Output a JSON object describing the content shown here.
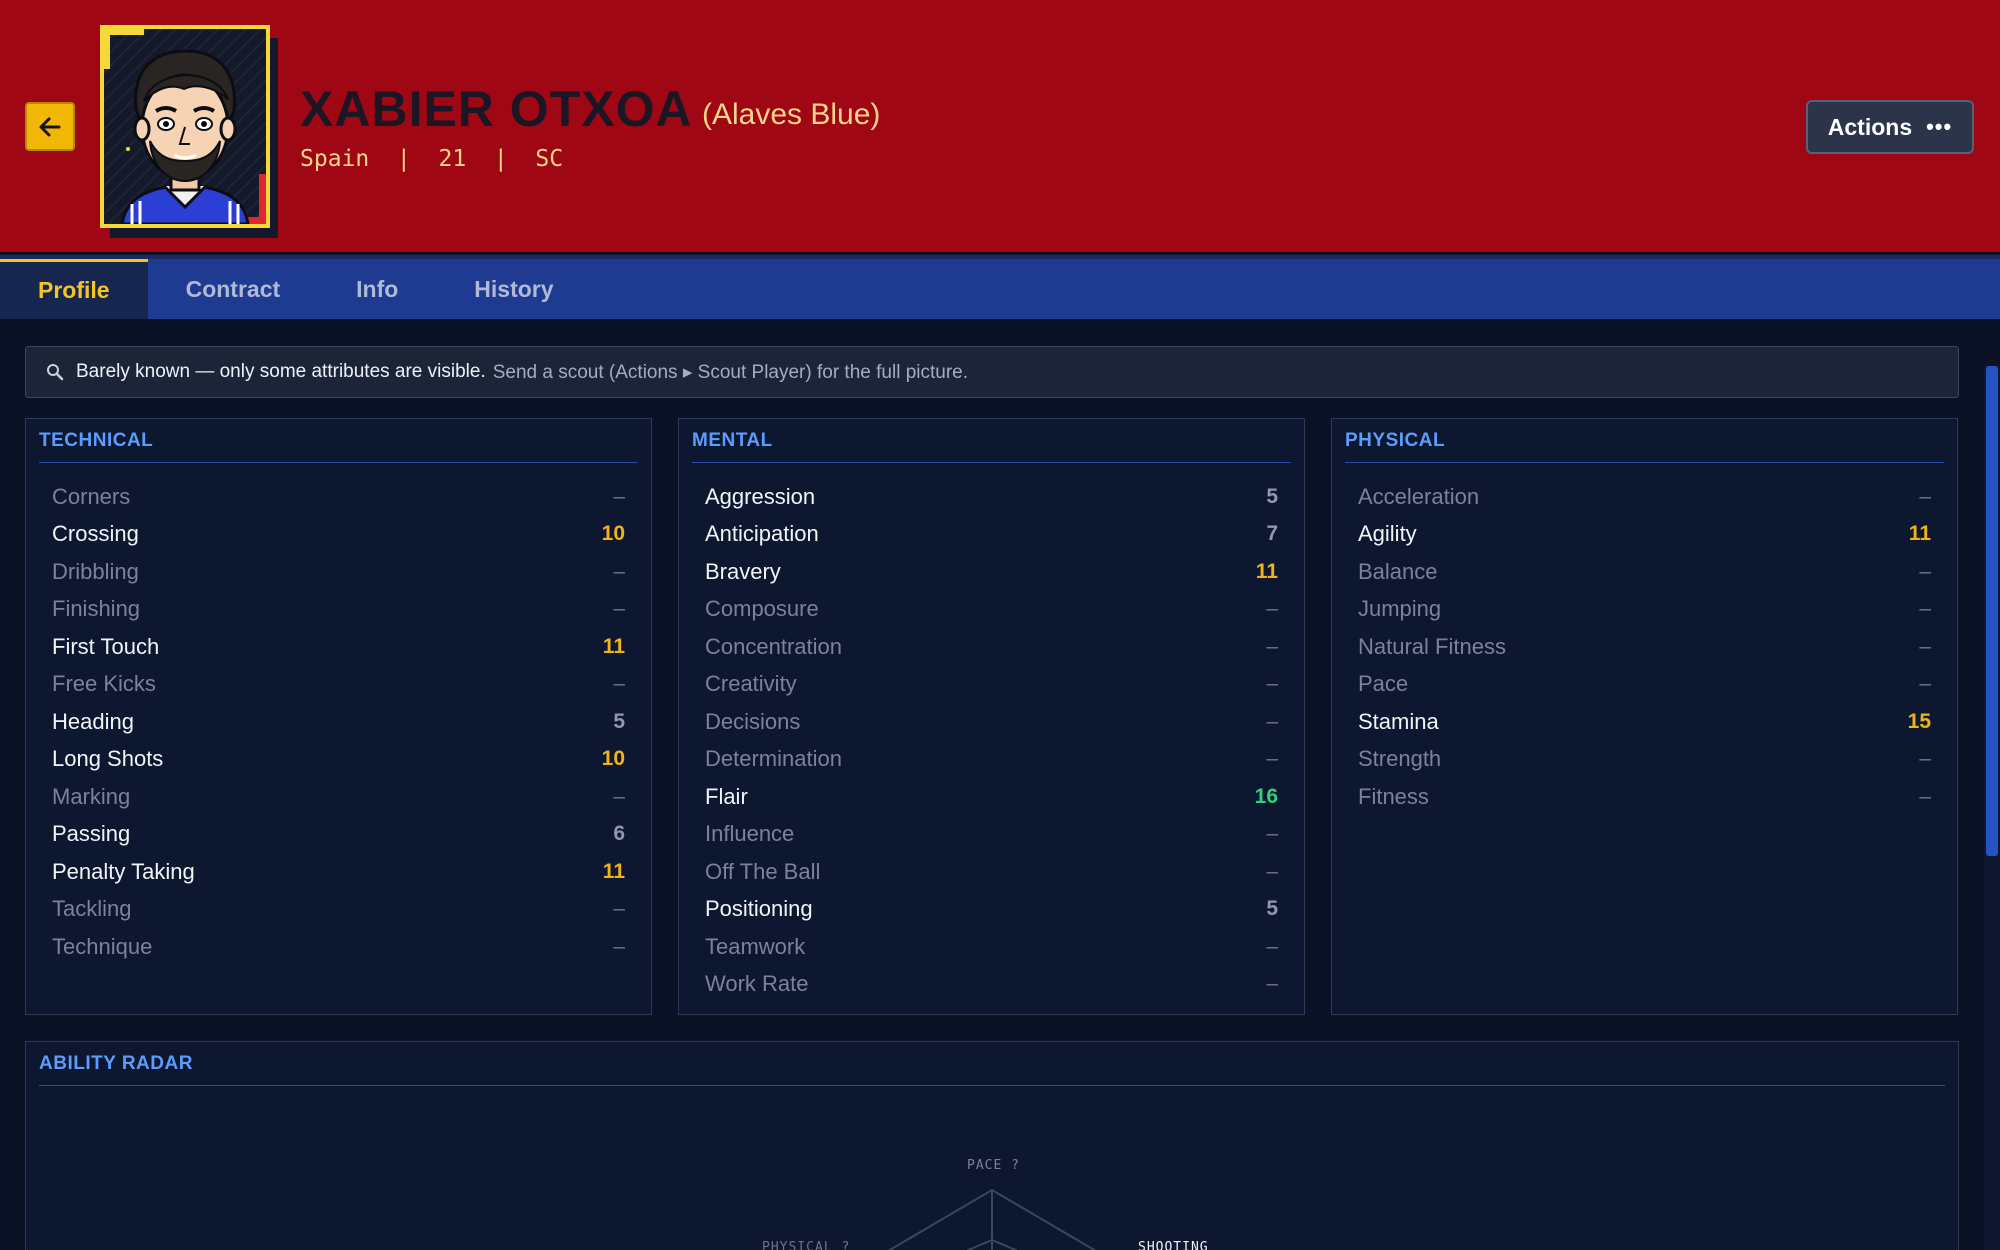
{
  "header": {
    "name": "XABIER OTXOA",
    "club": "(Alaves Blue)",
    "meta": "Spain  |  21  |  SC",
    "actions_label": "Actions",
    "actions_icon": "more-dots-icon",
    "back_icon": "arrow-left-icon"
  },
  "tabs": [
    "Profile",
    "Contract",
    "Info",
    "History"
  ],
  "active_tab": "Profile",
  "notice": {
    "icon": "magnifier-icon",
    "strong": "Barely known — only some attributes are visible.",
    "muted": "Send a scout (Actions ▸ Scout Player) for the full picture."
  },
  "technical": {
    "title": "TECHNICAL",
    "attributes": [
      {
        "name": "Corners",
        "value": "–"
      },
      {
        "name": "Crossing",
        "value": "10"
      },
      {
        "name": "Dribbling",
        "value": "–"
      },
      {
        "name": "Finishing",
        "value": "–"
      },
      {
        "name": "First Touch",
        "value": "11"
      },
      {
        "name": "Free Kicks",
        "value": "–"
      },
      {
        "name": "Heading",
        "value": "5"
      },
      {
        "name": "Long Shots",
        "value": "10"
      },
      {
        "name": "Marking",
        "value": "–"
      },
      {
        "name": "Passing",
        "value": "6"
      },
      {
        "name": "Penalty Taking",
        "value": "11"
      },
      {
        "name": "Tackling",
        "value": "–"
      },
      {
        "name": "Technique",
        "value": "–"
      }
    ]
  },
  "mental": {
    "title": "MENTAL",
    "attributes": [
      {
        "name": "Aggression",
        "value": "5"
      },
      {
        "name": "Anticipation",
        "value": "7"
      },
      {
        "name": "Bravery",
        "value": "11"
      },
      {
        "name": "Composure",
        "value": "–"
      },
      {
        "name": "Concentration",
        "value": "–"
      },
      {
        "name": "Creativity",
        "value": "–"
      },
      {
        "name": "Decisions",
        "value": "–"
      },
      {
        "name": "Determination",
        "value": "–"
      },
      {
        "name": "Flair",
        "value": "16"
      },
      {
        "name": "Influence",
        "value": "–"
      },
      {
        "name": "Off The Ball",
        "value": "–"
      },
      {
        "name": "Positioning",
        "value": "5"
      },
      {
        "name": "Teamwork",
        "value": "–"
      },
      {
        "name": "Work Rate",
        "value": "–"
      }
    ]
  },
  "physical": {
    "title": "PHYSICAL",
    "attributes": [
      {
        "name": "Acceleration",
        "value": "–"
      },
      {
        "name": "Agility",
        "value": "11"
      },
      {
        "name": "Balance",
        "value": "–"
      },
      {
        "name": "Jumping",
        "value": "–"
      },
      {
        "name": "Natural Fitness",
        "value": "–"
      },
      {
        "name": "Pace",
        "value": "–"
      },
      {
        "name": "Stamina",
        "value": "15"
      },
      {
        "name": "Strength",
        "value": "–"
      },
      {
        "name": "Fitness",
        "value": "–"
      }
    ]
  },
  "radar": {
    "title": "ABILITY RADAR",
    "labels": {
      "pace": "PACE ?",
      "physical": "PHYSICAL ?",
      "shooting": "SHOOTING"
    }
  },
  "colors": {
    "header_bg": "#a00714",
    "accent_gold": "#f0b419",
    "accent_green": "#2fd17a",
    "title_blue": "#5b9dff",
    "tab_bar": "#1f3a91"
  }
}
